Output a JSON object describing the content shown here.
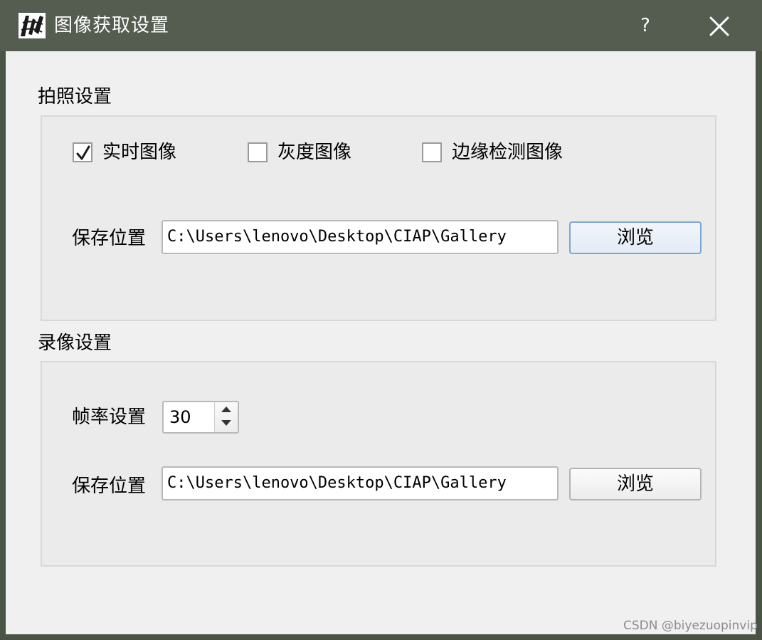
{
  "window": {
    "title": "图像获取设置",
    "help_label": "?"
  },
  "photo": {
    "section_title": "拍照设置",
    "checkboxes": [
      {
        "label": "实时图像",
        "checked": true
      },
      {
        "label": "灰度图像",
        "checked": false
      },
      {
        "label": "边缘检测图像",
        "checked": false
      }
    ],
    "save_label": "保存位置",
    "save_path": "C:\\Users\\lenovo\\Desktop\\CIAP\\Gallery",
    "browse_label": "浏览"
  },
  "video": {
    "section_title": "录像设置",
    "framerate_label": "帧率设置",
    "framerate_value": "30",
    "save_label": "保存位置",
    "save_path": "C:\\Users\\lenovo\\Desktop\\CIAP\\Gallery",
    "browse_label": "浏览"
  },
  "watermark": "CSDN @biyezuopinvip",
  "colors": {
    "titlebar": "#545d50",
    "client_bg": "#f0f0f0",
    "group_bg": "#ebebeb",
    "focus_border": "#7aa7d8"
  },
  "icons": {
    "app": "app-logo-icon",
    "close": "close-icon",
    "check": "checkmark-icon",
    "spin_up": "arrow-up-icon",
    "spin_down": "arrow-down-icon"
  }
}
